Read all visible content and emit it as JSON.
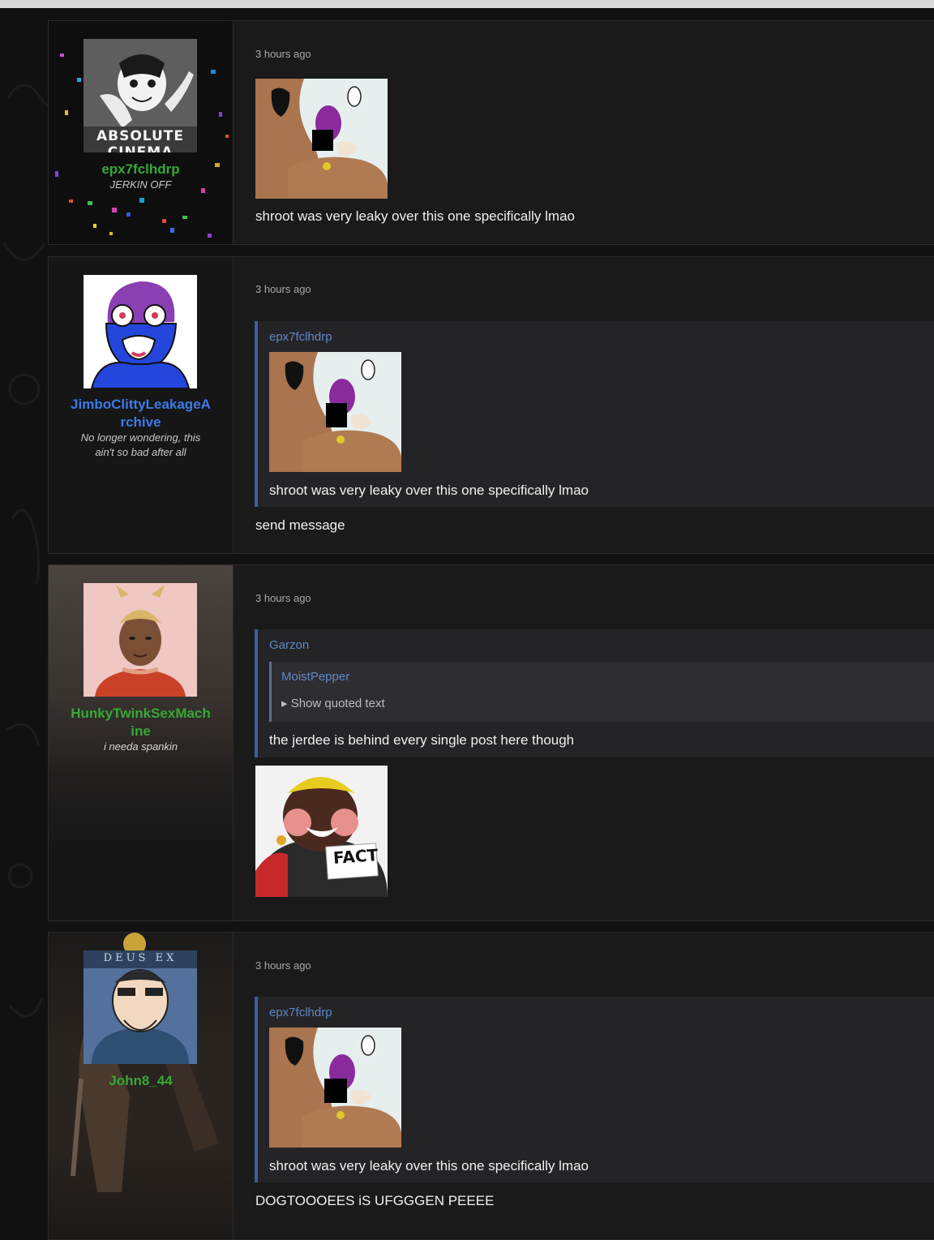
{
  "posts": [
    {
      "username": "epx7fclhdrp",
      "user_title": "JERKIN OFF",
      "avatar_caption": "ABSOLUTE CINEMA",
      "timestamp": "3 hours ago",
      "message": "shroot was very leaky over this one specifically lmao"
    },
    {
      "username_line1": "JimboClittyLeakageA",
      "username_line2": "rchive",
      "user_title_line1": "No longer wondering, this",
      "user_title_line2": "ain't so bad after all",
      "timestamp": "3 hours ago",
      "quote_author": "epx7fclhdrp",
      "quote_text": "shroot was very leaky over this one specifically lmao",
      "message": "send message"
    },
    {
      "username_line1": "HunkyTwinkSexMach",
      "username_line2": "ine",
      "user_title": "i needa spankin",
      "timestamp": "3 hours ago",
      "quote_author": "Garzon",
      "inner_quote_author": "MoistPepper",
      "inner_quote_toggle": "▸ Show quoted text",
      "quote_text": "the jerdee is behind every single post here though",
      "image_caption": "FACT"
    },
    {
      "username": "John8_44",
      "avatar_caption": "DEUS EX",
      "timestamp": "3 hours ago",
      "quote_author": "epx7fclhdrp",
      "quote_text": "shroot was very leaky over this one specifically lmao",
      "message": "DOGTOOOEES iS UFGGGEN PEEEE"
    }
  ],
  "colors": {
    "username_green": "#36a836",
    "username_blue": "#3b7ae6",
    "quote_border": "#3f5f9c"
  }
}
